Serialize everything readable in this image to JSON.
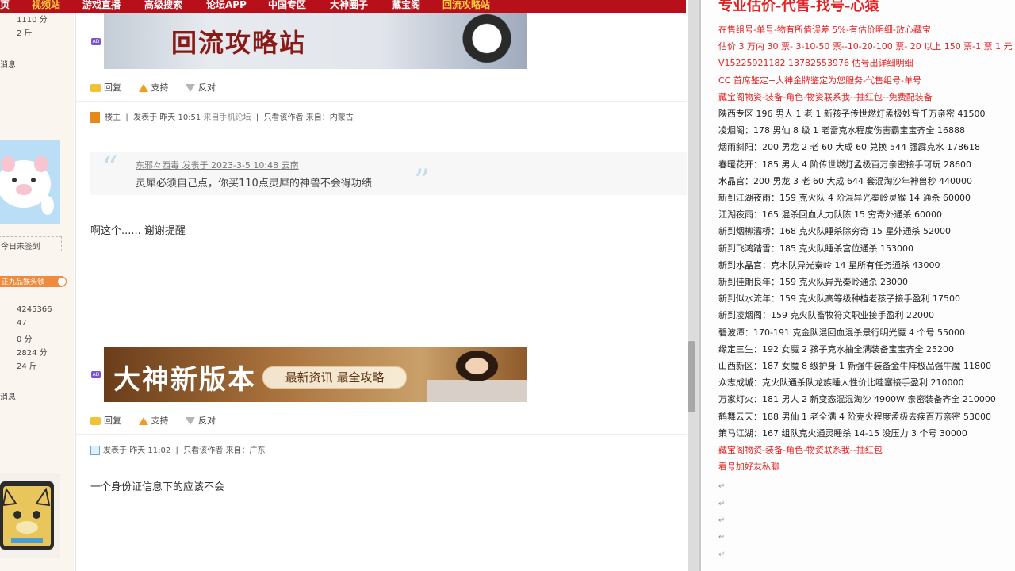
{
  "nav": {
    "items": [
      "页",
      "视频站",
      "游戏直播",
      "高级搜索",
      "论坛APP",
      "中国专区",
      "大神圈子",
      "藏宝阁",
      "回流攻略站"
    ]
  },
  "sidebar": {
    "user1_score": "1110 分",
    "user1_weight": "2 斤",
    "user1_msg": "消息",
    "sign_label": "今日未签到",
    "rank_label": "正九品猴头领",
    "user2_stats": [
      "4245366",
      "47",
      "0 分",
      "2824 分",
      "24 斤"
    ],
    "user2_msg": "消息"
  },
  "post1": {
    "banner_text": "回流攻略站",
    "ad_label": "AD",
    "actions": {
      "reply": "回复",
      "support": "支持",
      "oppose": "反对"
    }
  },
  "reply1": {
    "role": "楼主",
    "posted_label": "发表于",
    "time": "昨天 10:51",
    "source": "来自手机论坛",
    "author_only": "只看该作者",
    "location": "来自：内蒙古",
    "quote_author": "东邪々西毒 发表于 2023-3-5 10:48 云南",
    "quote_text": "灵犀必须自己点，你买110点灵犀的神兽不会得功绩",
    "body": "啊这个......  谢谢提醒"
  },
  "post2": {
    "banner_text": "大神新版本",
    "banner_sub": "最新资讯 最全攻略",
    "ad_label": "AD",
    "actions": {
      "reply": "回复",
      "support": "支持",
      "oppose": "反对"
    }
  },
  "reply2": {
    "posted_label": "发表于",
    "time": "昨天 11:02",
    "author_only": "只看该作者",
    "location": "来自：广东",
    "body": "一个身份证信息下的应该不会"
  },
  "right_panel": {
    "title": "专业估价-代售-找号-心猿",
    "lines": [
      {
        "text": "在售组号-单号-物有所值误差 5%-有估价明细-放心藏宝",
        "color": "red"
      },
      {
        "text": "估价 3 万内 30 票- 3-10-50 票--10-20-100 票- 20 以上 150 票-1 票 1 元",
        "color": "red"
      },
      {
        "text": "V15225921182      13782553976    估号出详细明细",
        "color": "red"
      },
      {
        "text": "CC 首席鉴定+大神金牌鉴定为您服务-代售组号-单号",
        "color": "red"
      },
      {
        "text": "藏宝阁物资-装备-角色-物资联系我--抽红包--免费配装备",
        "color": "red"
      },
      {
        "text": "陕西专区 196 男人 1 老 1 新孩子传世燃灯孟极妙音千万亲密 41500",
        "color": "black"
      },
      {
        "text": "凌烟阁：178 男仙 8 级 1 老雷克水程度伤害霸宝宝齐全 16888",
        "color": "black"
      },
      {
        "text": "烟雨斜阳：200 男龙 2 老 60 大成 60 兑换 544 强霹克水 178618",
        "color": "black"
      },
      {
        "text": "春暖花开：185 男人 4 阶传世燃灯孟极百万亲密接手可玩 28600",
        "color": "black"
      },
      {
        "text": "水晶宫：200 男龙 3 老 60 大成 644 套混淘沙年神兽秒 440000",
        "color": "black"
      },
      {
        "text": "新到江湖夜雨：159 克火队 4 阶混异光秦岭灵猴 14 通杀 60000",
        "color": "black"
      },
      {
        "text": "江湖夜雨：165 混杀回血大力队陈 15 穷奇外通杀 60000",
        "color": "black"
      },
      {
        "text": "新到烟柳灞桥：168 克火队睡杀除穷奇 15 星外通杀 52000",
        "color": "black"
      },
      {
        "text": "新到飞鸿踏雪：185 克火队睡杀宫位通杀 153000",
        "color": "black"
      },
      {
        "text": "新到水晶宫：克木队异光秦岭 14 星所有任务通杀 43000",
        "color": "black"
      },
      {
        "text": "新到佳期良年：159 克火队异光秦岭通杀 23000",
        "color": "black"
      },
      {
        "text": "新到似水流年：159 克火队高等级种植老孩子接手盈利 17500",
        "color": "black"
      },
      {
        "text": "新到凌烟阁：159 克火队畜牧符文职业接手盈利 22000",
        "color": "black"
      },
      {
        "text": "碧波潭：170-191 克金队混回血混杀景行明光魔 4 个号 55000",
        "color": "black"
      },
      {
        "text": "缘定三生：192 女魔 2 孩子克水抽全满装备宝宝齐全 25200",
        "color": "black"
      },
      {
        "text": "山西新区：187 女魔 8 级护身 1 新强牛装备金牛阵极品强牛魔 11800",
        "color": "black"
      },
      {
        "text": "众志成城：克火队通杀队龙族睡人性价比哇塞接手盈利 210000",
        "color": "black"
      },
      {
        "text": "万家灯火：181 男人 2 新变态混混淘沙 4900W 亲密装备齐全 210000",
        "color": "black"
      },
      {
        "text": "鹤舞云天：188 男仙 1 老全满 4 阶克火程度孟极去疾百万亲密 53000",
        "color": "black"
      },
      {
        "text": "策马江湖：167 组队克火通灵睡杀 14-15 没压力 3 个号 30000",
        "color": "black"
      },
      {
        "text": "藏宝阁物资-装备-角色-物资联系我--抽红包",
        "color": "red"
      },
      {
        "text": "看号加好友私聊",
        "color": "red"
      }
    ]
  },
  "colors": {
    "nav_bg": "#b8101a",
    "accent_red": "#e52020",
    "nav_highlight": "#ffd23c"
  }
}
